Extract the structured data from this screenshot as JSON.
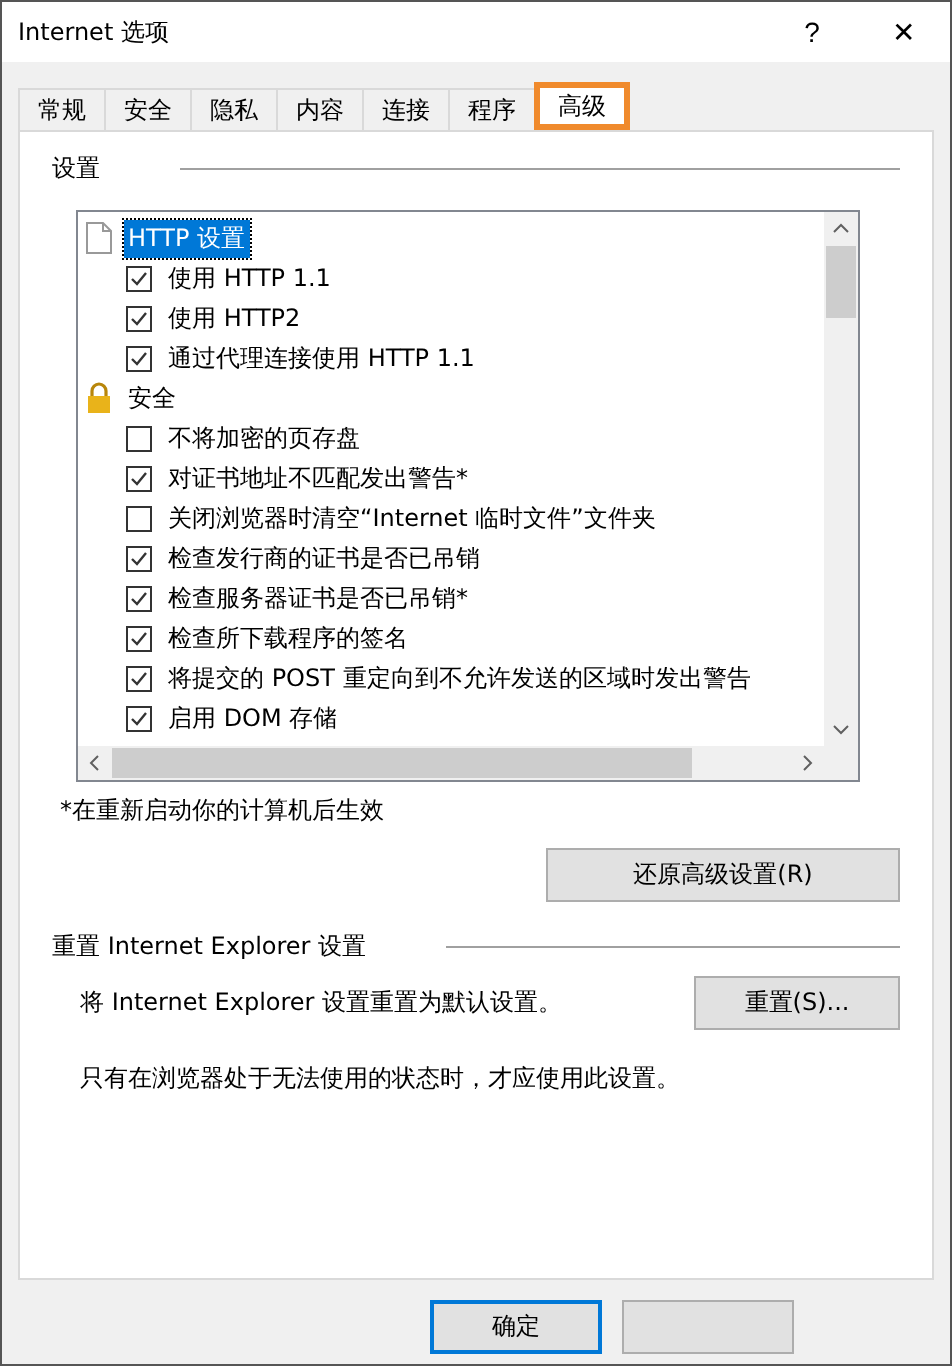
{
  "window": {
    "title": "Internet 选项",
    "help": "?",
    "close": "✕"
  },
  "tabs": [
    {
      "label": "常规",
      "selected": false,
      "highlighted": false
    },
    {
      "label": "安全",
      "selected": false,
      "highlighted": false
    },
    {
      "label": "隐私",
      "selected": false,
      "highlighted": false
    },
    {
      "label": "内容",
      "selected": false,
      "highlighted": false
    },
    {
      "label": "连接",
      "selected": false,
      "highlighted": false
    },
    {
      "label": "程序",
      "selected": false,
      "highlighted": false
    },
    {
      "label": "高级",
      "selected": true,
      "highlighted": true
    }
  ],
  "settings": {
    "heading": "设置",
    "items": [
      {
        "kind": "page_group",
        "label": "HTTP 设置",
        "selected": true
      },
      {
        "kind": "check",
        "label": "使用 HTTP 1.1",
        "checked": true
      },
      {
        "kind": "check",
        "label": "使用 HTTP2",
        "checked": true
      },
      {
        "kind": "check",
        "label": "通过代理连接使用 HTTP 1.1",
        "checked": true
      },
      {
        "kind": "lock_group",
        "label": "安全",
        "selected": false
      },
      {
        "kind": "check",
        "label": "不将加密的页存盘",
        "checked": false
      },
      {
        "kind": "check",
        "label": "对证书地址不匹配发出警告*",
        "checked": true
      },
      {
        "kind": "check",
        "label": "关闭浏览器时清空“Internet 临时文件”文件夹",
        "checked": false
      },
      {
        "kind": "check",
        "label": "检查发行商的证书是否已吊销",
        "checked": true
      },
      {
        "kind": "check",
        "label": "检查服务器证书是否已吊销*",
        "checked": true
      },
      {
        "kind": "check",
        "label": "检查所下载程序的签名",
        "checked": true
      },
      {
        "kind": "check",
        "label": "将提交的 POST 重定向到不允许发送的区域时发出警告",
        "checked": true
      },
      {
        "kind": "check",
        "label": "启用 DOM 存储",
        "checked": true
      }
    ],
    "note": "*在重新启动你的计算机后生效",
    "restore_button": "还原高级设置(R)"
  },
  "reset": {
    "heading": "重置 Internet Explorer 设置",
    "description": "将 Internet Explorer 设置重置为默认设置。",
    "button": "重置(S)...",
    "warning": "只有在浏览器处于无法使用的状态时，才应使用此设置。"
  },
  "buttons": [
    {
      "label": "确定",
      "default": true
    },
    {
      "default": false
    }
  ]
}
